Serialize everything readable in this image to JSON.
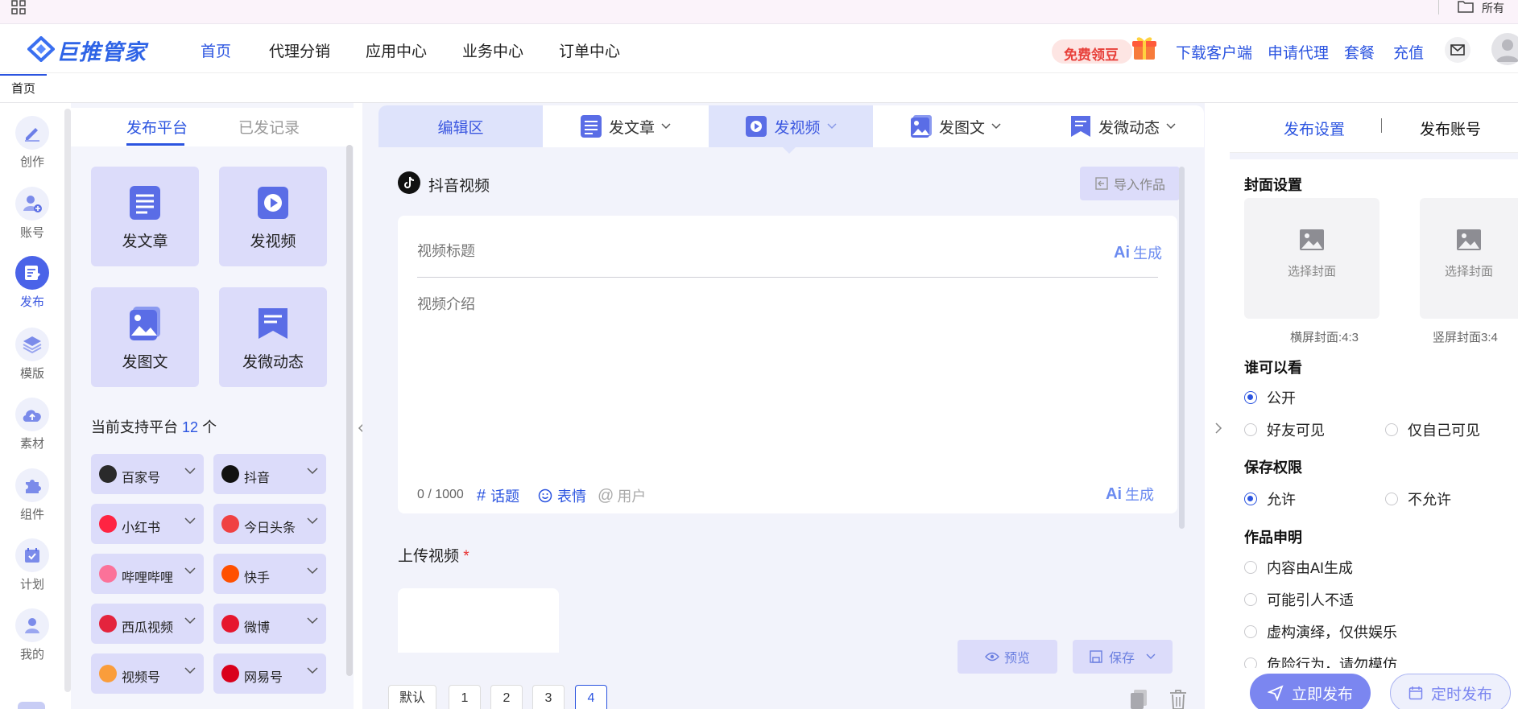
{
  "topbar": {
    "right_label": "所有"
  },
  "header": {
    "logo": "巨推管家",
    "nav": [
      "首页",
      "代理分销",
      "应用中心",
      "业务中心",
      "订单中心"
    ],
    "free_beans": "免费领豆",
    "links": [
      "下载客户端",
      "申请代理",
      "套餐",
      "充值"
    ]
  },
  "tabbar": {
    "home_tab": "首页"
  },
  "sidebar": {
    "items": [
      {
        "label": "创作",
        "icon": "pen-icon"
      },
      {
        "label": "账号",
        "icon": "user-add-icon"
      },
      {
        "label": "发布",
        "icon": "publish-icon"
      },
      {
        "label": "模版",
        "icon": "layers-icon"
      },
      {
        "label": "素材",
        "icon": "cloud-upload-icon"
      },
      {
        "label": "组件",
        "icon": "puzzle-icon"
      },
      {
        "label": "计划",
        "icon": "calendar-icon"
      },
      {
        "label": "我的",
        "icon": "person-icon"
      }
    ]
  },
  "publish_panel": {
    "tabs": [
      "发布平台",
      "已发记录"
    ],
    "cards": [
      "发文章",
      "发视频",
      "发图文",
      "发微动态"
    ],
    "support_text": "当前支持平台",
    "support_count": "12",
    "support_unit": "个",
    "platforms": [
      {
        "name": "百家号",
        "color": "#2a2a2a"
      },
      {
        "name": "抖音",
        "color": "#111111"
      },
      {
        "name": "小红书",
        "color": "#ff2442"
      },
      {
        "name": "今日头条",
        "color": "#f04142"
      },
      {
        "name": "哔哩哔哩",
        "color": "#fb7299"
      },
      {
        "name": "快手",
        "color": "#ff5000"
      },
      {
        "name": "西瓜视频",
        "color": "#e4243d"
      },
      {
        "name": "微博",
        "color": "#e6162d"
      },
      {
        "name": "视频号",
        "color": "#fa9d3b"
      },
      {
        "name": "网易号",
        "color": "#d9001b"
      }
    ]
  },
  "editor": {
    "tabs": [
      "编辑区",
      "发文章",
      "发视频",
      "发图文",
      "发微动态"
    ],
    "platform_title": "抖音视频",
    "import_btn": "导入作品",
    "title_placeholder": "视频标题",
    "ai_generate": "生成",
    "desc_placeholder": "视频介绍",
    "counter": "0 / 1000",
    "topic": "话题",
    "emoji": "表情",
    "user": "用户",
    "upload_label": "上传视频",
    "required_mark": "*",
    "preview_btn": "预览",
    "save_btn": "保存",
    "pages": [
      "默认",
      "1",
      "2",
      "3",
      "4"
    ]
  },
  "settings": {
    "tabs": [
      "发布设置",
      "发布账号"
    ],
    "cover_title": "封面设置",
    "cover_select": "选择封面",
    "cover_h": "横屏封面:4:3",
    "cover_v": "竖屏封面3:4",
    "visibility_title": "谁可以看",
    "visibility": [
      "公开",
      "好友可见",
      "仅自己可见"
    ],
    "save_title": "保存权限",
    "save_opts": [
      "允许",
      "不允许"
    ],
    "declare_title": "作品申明",
    "declare_opts": [
      "内容由AI生成",
      "可能引人不适",
      "虚构演绎，仅供娱乐",
      "危险行为，请勿模仿"
    ],
    "publish_now": "立即发布",
    "publish_timed": "定时发布"
  },
  "colors": {
    "accent": "#2b54e0",
    "card": "#dcdcfa",
    "panel": "#f4f5fc"
  }
}
